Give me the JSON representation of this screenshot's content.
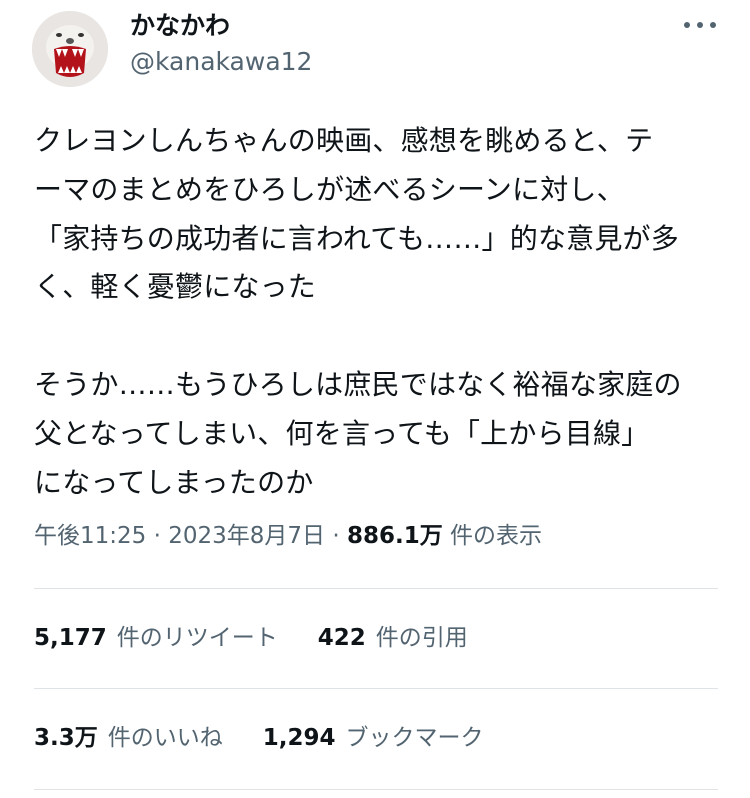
{
  "user": {
    "display_name": "かなかわ",
    "handle": "@kanakawa12",
    "avatar_icon": "wolf-mask-avatar-icon"
  },
  "header": {
    "more_icon": "more-options-icon"
  },
  "tweet": {
    "lines": [
      "クレヨンしんちゃんの映画、感想を眺めると、テ",
      "ーマのまとめをひろしが述べるシーンに対し、",
      "「家持ちの成功者に言われても……」的な意見が多",
      "く、軽く憂鬱になった",
      "",
      "そうか……もうひろしは庶民ではなく裕福な家庭の",
      "父となってしまい、何を言っても「上から目線」",
      "になってしまったのか"
    ]
  },
  "meta": {
    "time": "午後11:25",
    "sep1": " · ",
    "date": "2023年8月7日",
    "sep2": " · ",
    "view_count": "886.1万",
    "view_label": " 件の表示"
  },
  "stats": {
    "retweets": {
      "value": "5,177",
      "label": "件のリツイート"
    },
    "quotes": {
      "value": "422",
      "label": "件の引用"
    },
    "likes": {
      "value": "3.3万",
      "label": "件のいいね"
    },
    "bookmarks": {
      "value": "1,294",
      "label": "ブックマーク"
    }
  },
  "colors": {
    "text_primary": "#0f1419",
    "text_secondary": "#536471",
    "divider": "#dfe3e6"
  }
}
